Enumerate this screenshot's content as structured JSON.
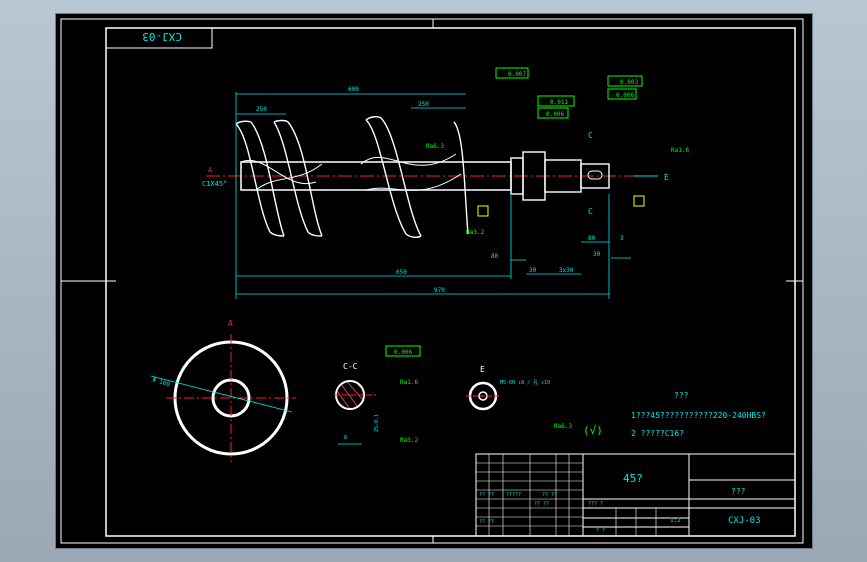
{
  "drawing": {
    "title_block_tag": "CXJ-03",
    "colors": {
      "background": "#000000",
      "frame": "#ffffff",
      "dimension": "#00e5e5",
      "annotation": "#00ff00",
      "centerline": "#ff2020",
      "part": "#ffffff",
      "leader": "#ffff00",
      "hatch": "#ff5050"
    },
    "top_view": {
      "label_a": "A",
      "chamfer_note": "C1X45°",
      "dims": {
        "overall_screw": "600",
        "pitch_1": "250",
        "pitch_2": "250",
        "shaft_len": "650",
        "total": "970",
        "d1": "30",
        "d2": "3x30",
        "d3": "80",
        "d4": "3",
        "d5": "30",
        "d6": "80"
      },
      "tolerance_tags": [
        "0.007",
        "0.011",
        "0.006",
        "0.003",
        "0.006"
      ],
      "section_c": "C",
      "section_e": "E",
      "roughness": [
        "Ra6.3",
        "Ra1.6",
        "Ra3.2"
      ]
    },
    "views": {
      "a_view_label": "A",
      "a_view_dim": "Φ 100",
      "c_section_label": "C-C",
      "c_tol": "0.006",
      "e_view_label": "E",
      "e_note": "M5-6H ↧8 / 孔 ↧10",
      "c_dims": [
        "8",
        "25-0.1"
      ]
    },
    "notes": {
      "heading": "???",
      "line1": "1???45???????????220-240HBS?",
      "line2": "2 ?????C16?",
      "roughness_all": "Ra6.3",
      "check_mark": "(√)"
    },
    "title_block": {
      "material": "45?",
      "name": "???",
      "code": "CXJ-03",
      "scale": "1:2",
      "cells": [
        "?? ??",
        "?????",
        "?? ??",
        "?? ??",
        "?? ??",
        "??? ?",
        "? ?"
      ]
    }
  }
}
